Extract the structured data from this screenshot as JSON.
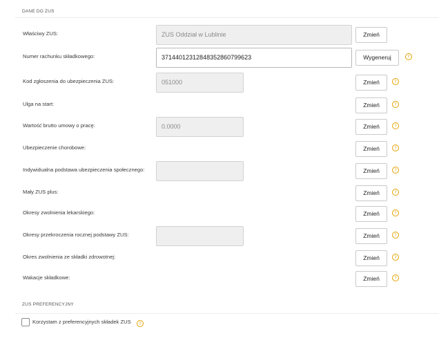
{
  "section1": {
    "title": "DANE DO ZUS"
  },
  "rows": [
    {
      "label": "Właściwy ZUS:",
      "value": "ZUS Oddział w Lublinie",
      "button": "Zmień"
    },
    {
      "label": "Numer rachunku składkowego:",
      "value": "37144012312848352860799623",
      "button": "Wygeneruj"
    },
    {
      "label": "Kod zgłoszenia do ubezpieczenia ZUS:",
      "value": "051000",
      "button": "Zmień"
    },
    {
      "label": "Ulga na start:",
      "button": "Zmień"
    },
    {
      "label": "Wartość brutto umowy o pracę:",
      "value": "0.0000",
      "button": "Zmień"
    },
    {
      "label": "Ubezpieczenie chorobowe:",
      "button": "Zmień"
    },
    {
      "label": "Indywidualna podstawa ubezpieczenia społecznego:",
      "value": "",
      "button": "Zmień"
    },
    {
      "label": "Mały ZUS plus:",
      "button": "Zmień"
    },
    {
      "label": "Okresy zwolnienia lekarskiego:",
      "button": "Zmień"
    },
    {
      "label": "Okresy przekroczenia rocznej podstawy ZUS:",
      "value": "",
      "button": "Zmień"
    },
    {
      "label": "Okres zwolnienia ze składki zdrowotnej:",
      "button": "Zmień"
    },
    {
      "label": "Wakacje składkowe:",
      "button": "Zmień"
    }
  ],
  "section2": {
    "title": "ZUS PREFERENCYJNY",
    "checkbox_label": "Korzystam z preferencyjnych składek ZUS"
  },
  "icons": {
    "info": "info-circle-icon",
    "accent": "#e3a200"
  }
}
